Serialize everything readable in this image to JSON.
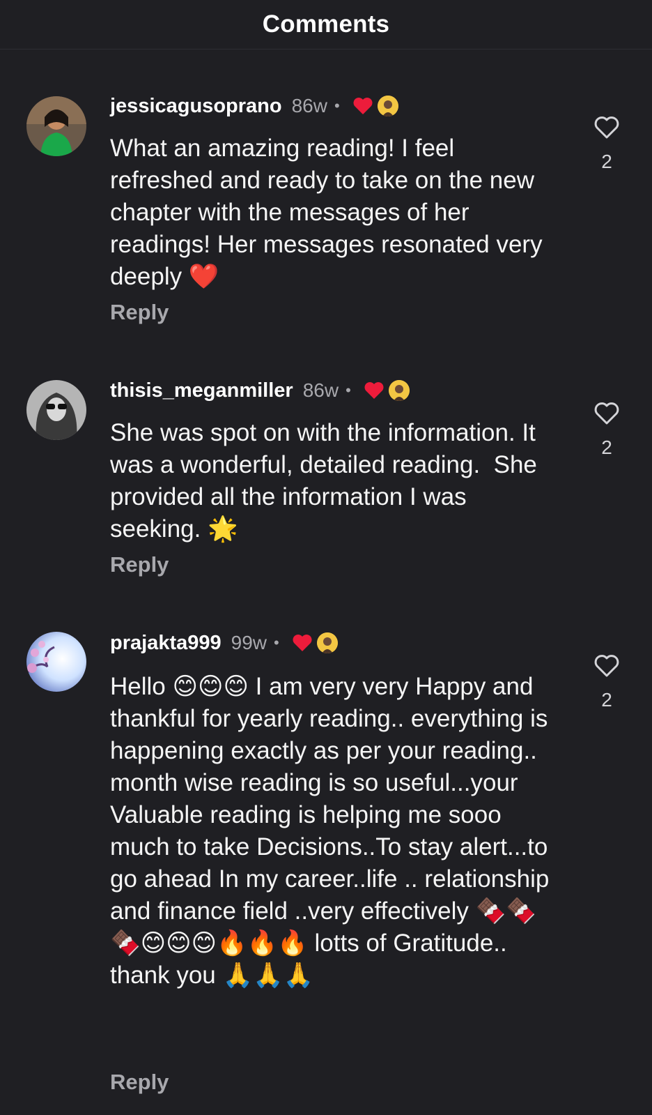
{
  "header": {
    "title": "Comments"
  },
  "comments": [
    {
      "username": "jessicagusoprano",
      "time": "86w",
      "dot": "•",
      "text": "What an amazing reading! I feel refreshed and ready to take on the new chapter with the messages of her readings! Her messages resonated very deeply ❤️",
      "reply": "Reply",
      "likes": "2",
      "avatar_icon": "profile-photo-icon"
    },
    {
      "username": "thisis_meganmiller",
      "time": "86w",
      "dot": "•",
      "text": "She was spot on with the information. It was a wonderful, detailed reading.  She provided all the information I was seeking. 🌟",
      "reply": "Reply",
      "likes": "2",
      "avatar_icon": "profile-photo-icon"
    },
    {
      "username": "prajakta999",
      "time": "99w",
      "dot": "•",
      "text": "Hello 😊😊😊 I am very very Happy and thankful for yearly reading.. everything is happening exactly as per your reading.. month wise reading is so useful...your Valuable reading is helping me sooo much to take Decisions..To stay alert...to go ahead In my career..life .. relationship and finance field ..very effectively 🍫🍫🍫😊😊😊🔥🔥🔥 lotts of Gratitude.. thank you 🙏🙏🙏",
      "reply": "Reply",
      "likes": "2",
      "avatar_icon": "profile-photo-icon"
    }
  ],
  "colors": {
    "background": "#1f1f23",
    "secondary_text": "#a8a8ad",
    "creator_heart": "#ed1c3b",
    "creator_badge": "#f3c643"
  }
}
